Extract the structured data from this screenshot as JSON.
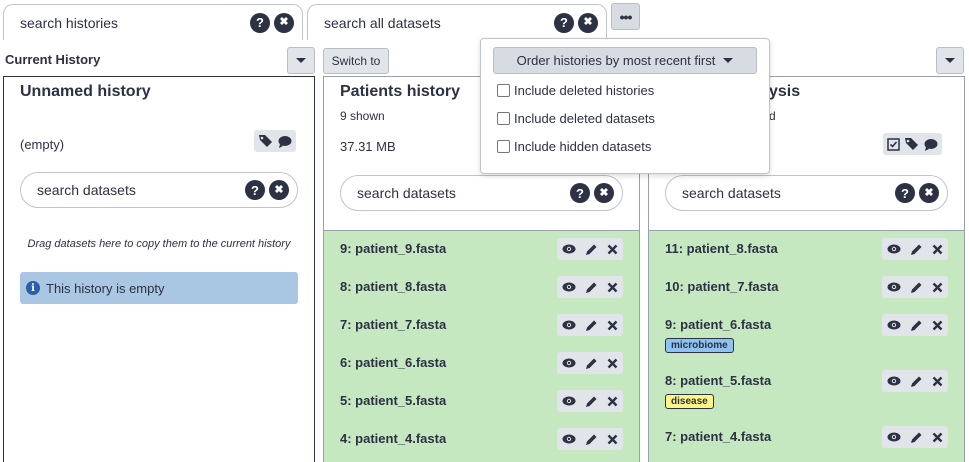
{
  "top": {
    "search_histories": "search histories",
    "search_datasets": "search all datasets",
    "more_label": "•••"
  },
  "current": {
    "header": "Current History",
    "switch_label": "Switch to",
    "title": "Unnamed history",
    "status": "(empty)",
    "search_placeholder": "search datasets",
    "drag_hint": "Drag datasets here to copy them to the current history",
    "empty_message": "This history is empty"
  },
  "menu": {
    "order_label": "Order histories by most recent first",
    "options": [
      {
        "label": "Include deleted histories",
        "checked": false
      },
      {
        "label": "Include deleted datasets",
        "checked": false
      },
      {
        "label": "Include hidden datasets",
        "checked": false
      }
    ]
  },
  "patients": {
    "title": "Patients history",
    "shown": "9 shown",
    "size": "37.31 MB",
    "search_placeholder": "search datasets",
    "items": [
      {
        "name": "9: patient_9.fasta"
      },
      {
        "name": "8: patient_8.fasta"
      },
      {
        "name": "7: patient_7.fasta"
      },
      {
        "name": "6: patient_6.fasta"
      },
      {
        "name": "5: patient_5.fasta"
      },
      {
        "name": "4: patient_4.fasta"
      }
    ]
  },
  "analysis": {
    "title_visible": "ysis",
    "sub_visible": "d",
    "search_placeholder": "search datasets",
    "items": [
      {
        "name": "11: patient_8.fasta",
        "tag": ""
      },
      {
        "name": "10: patient_7.fasta",
        "tag": ""
      },
      {
        "name": "9: patient_6.fasta",
        "tag": "microbiome"
      },
      {
        "name": "8: patient_5.fasta",
        "tag": "disease"
      },
      {
        "name": "7: patient_4.fasta",
        "tag": ""
      }
    ]
  },
  "help_glyph": "?",
  "clear_glyph": "✖",
  "info_glyph": "i",
  "colors": {
    "ok_state": "#c6e8c1",
    "info_box": "#a9c6e2",
    "tag_microbiome": "#8dc3ee",
    "tag_disease": "#fff685"
  }
}
